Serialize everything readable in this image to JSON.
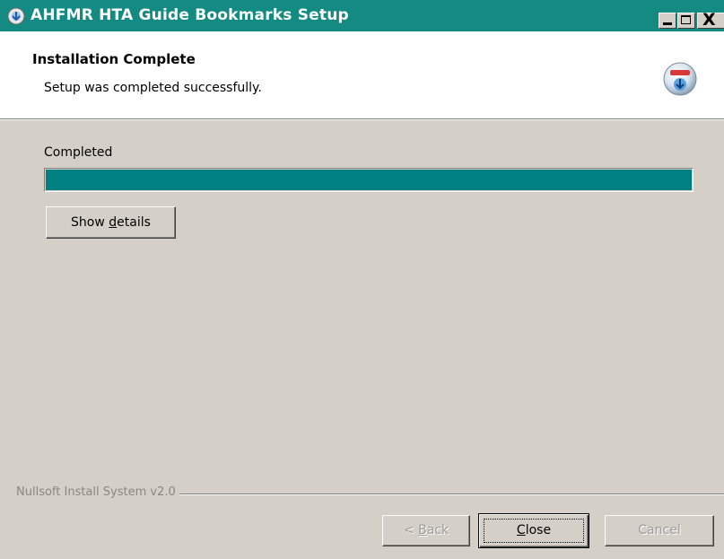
{
  "window": {
    "title": "AHFMR HTA Guide Bookmarks Setup",
    "minimize_label": "_",
    "close_label": "X"
  },
  "header": {
    "title": "Installation Complete",
    "subtitle": "Setup was completed successfully."
  },
  "content": {
    "status_label": "Completed",
    "progress_percent": 100,
    "progress_color": "#008080",
    "show_details_prefix": "Show ",
    "show_details_mnemonic": "d",
    "show_details_suffix": "etails"
  },
  "footer": {
    "branding": "Nullsoft Install System v2.0",
    "back_prefix": "< ",
    "back_mnemonic": "B",
    "back_suffix": "ack",
    "close_mnemonic": "C",
    "close_suffix": "lose",
    "cancel_label": "Cancel"
  },
  "colors": {
    "titlebar": "#138a82",
    "dialog_bg": "#d4d0c8",
    "header_bg": "#ffffff"
  }
}
